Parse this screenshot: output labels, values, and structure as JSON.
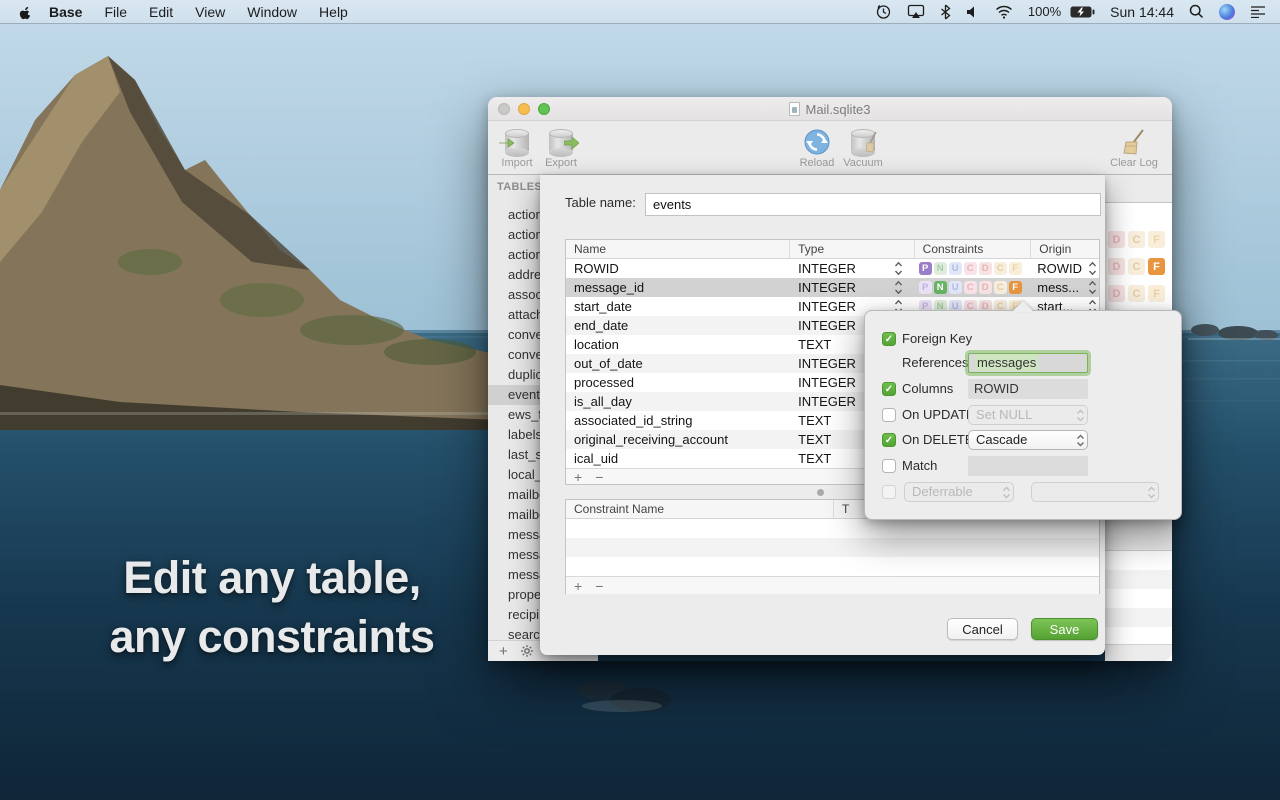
{
  "menu_bar": {
    "app_name": "Base",
    "menus": [
      "File",
      "Edit",
      "View",
      "Window",
      "Help"
    ],
    "battery_percent": "100%",
    "clock": "Sun 14:44"
  },
  "desktop": {
    "headline_line1": "Edit any table,",
    "headline_line2": "any constraints"
  },
  "window": {
    "title": "Mail.sqlite3",
    "toolbar": {
      "import_label": "Import",
      "export_label": "Export",
      "reload_label": "Reload",
      "vacuum_label": "Vacuum",
      "clear_log_label": "Clear Log"
    },
    "sidebar": {
      "header": "TABLES",
      "items": [
        {
          "label": "action"
        },
        {
          "label": "action"
        },
        {
          "label": "action"
        },
        {
          "label": "addres"
        },
        {
          "label": "associ"
        },
        {
          "label": "attach"
        },
        {
          "label": "conve"
        },
        {
          "label": "conve"
        },
        {
          "label": "duplic"
        },
        {
          "label": "events",
          "selected": true
        },
        {
          "label": "ews_f"
        },
        {
          "label": "labels"
        },
        {
          "label": "last_s"
        },
        {
          "label": "local_"
        },
        {
          "label": "mailbo"
        },
        {
          "label": "mailbo"
        },
        {
          "label": "messa"
        },
        {
          "label": "messa"
        },
        {
          "label": "messa"
        },
        {
          "label": "prope"
        },
        {
          "label": "recipi"
        },
        {
          "label": "searc"
        }
      ]
    },
    "underlying_rows": [
      {
        "active": []
      },
      {
        "active": [
          "F"
        ]
      },
      {
        "active": []
      },
      {
        "active": []
      }
    ]
  },
  "sheet": {
    "table_name_label": "Table name:",
    "table_name_value": "events",
    "columns_table": {
      "headers": [
        "Name",
        "Type",
        "Constraints",
        "Origin"
      ],
      "badge_letters": [
        "P",
        "N",
        "U",
        "C",
        "D",
        "C",
        "F"
      ],
      "rows": [
        {
          "name": "ROWID",
          "type": "INTEGER",
          "origin": "ROWID",
          "badges_active": [
            "P"
          ],
          "show_badges": true,
          "stepper": true
        },
        {
          "name": "message_id",
          "type": "INTEGER",
          "origin": "mess...",
          "badges_active": [
            "N",
            "F"
          ],
          "show_badges": true,
          "stepper": true,
          "selected": true
        },
        {
          "name": "start_date",
          "type": "INTEGER",
          "origin": "start...",
          "badges_active": [],
          "show_badges": true,
          "stepper": true
        },
        {
          "name": "end_date",
          "type": "INTEGER"
        },
        {
          "name": "location",
          "type": "TEXT"
        },
        {
          "name": "out_of_date",
          "type": "INTEGER"
        },
        {
          "name": "processed",
          "type": "INTEGER"
        },
        {
          "name": "is_all_day",
          "type": "INTEGER"
        },
        {
          "name": "associated_id_string",
          "type": "TEXT"
        },
        {
          "name": "original_receiving_account",
          "type": "TEXT"
        },
        {
          "name": "ical_uid",
          "type": "TEXT"
        }
      ]
    },
    "constraints_table": {
      "col1_header": "Constraint Name",
      "col2_header": "T"
    },
    "cancel_label": "Cancel",
    "save_label": "Save"
  },
  "popover": {
    "foreign_key_label": "Foreign Key",
    "references_label": "References",
    "references_value": "messages",
    "columns_label": "Columns",
    "columns_value": "ROWID",
    "on_update_label": "On UPDATE",
    "on_update_value": "Set NULL",
    "on_delete_label": "On DELETE",
    "on_delete_value": "Cascade",
    "match_label": "Match",
    "deferrable_label": "Deferrable"
  },
  "colors": {
    "accent_green": "#5fb044",
    "save_gradient_top": "#7dc457",
    "save_gradient_bottom": "#55a233",
    "selection_green": "#cfe5c2",
    "menubar_bg": "#cfe0ec",
    "sheet_bg": "#ececec",
    "selected_row": "#d2d2d2",
    "badge_palette": [
      {
        "letter": "P",
        "on_bg": "#9a7ec9",
        "off_bg": "#eae3f5",
        "off_fg": "#c3b2e0"
      },
      {
        "letter": "N",
        "on_bg": "#68b364",
        "off_bg": "#e0edde",
        "off_fg": "#a6cda3"
      },
      {
        "letter": "U",
        "on_bg": "#7b8fd4",
        "off_bg": "#e2e7f8",
        "off_fg": "#b0bce8"
      },
      {
        "letter": "C",
        "on_bg": "#d98a9a",
        "off_bg": "#f7e3e8",
        "off_fg": "#e4b6c1"
      },
      {
        "letter": "D",
        "on_bg": "#d98a8a",
        "off_bg": "#f7e3e3",
        "off_fg": "#e4b6b6"
      },
      {
        "letter": "C",
        "on_bg": "#d8b268",
        "off_bg": "#f7eedd",
        "off_fg": "#e2cda2"
      },
      {
        "letter": "F",
        "on_bg": "#e8953f",
        "off_bg": "#f9eeda",
        "off_fg": "#ecd2a4"
      }
    ]
  }
}
